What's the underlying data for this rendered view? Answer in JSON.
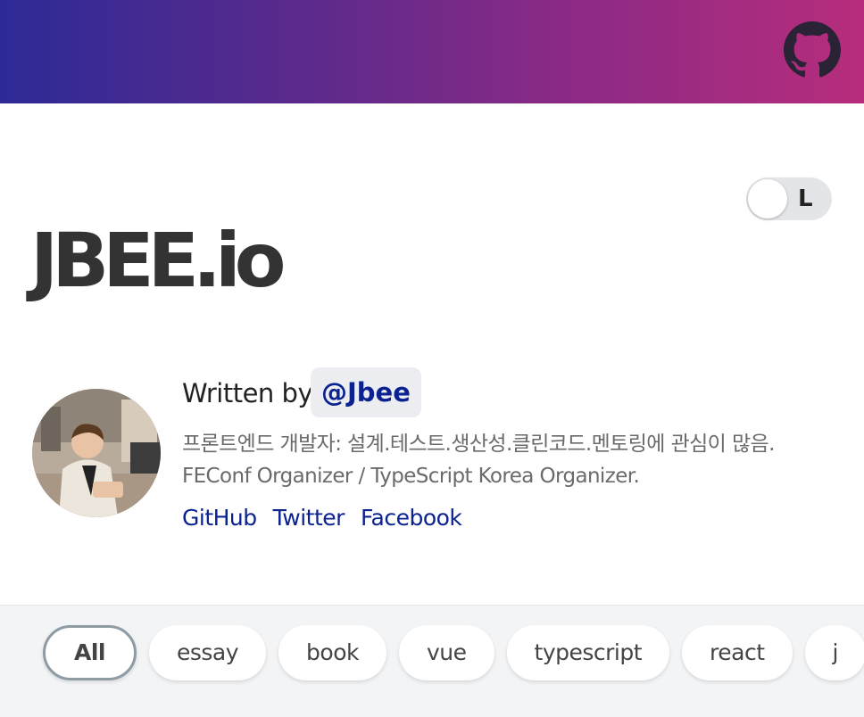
{
  "header": {
    "github_icon": "github-icon",
    "gradient_colors": [
      "#2d2a96",
      "#b72d7c"
    ]
  },
  "theme_toggle": {
    "label": "L"
  },
  "site": {
    "title": "JBEE.io"
  },
  "bio": {
    "written_by": "Written by",
    "handle": "@Jbee",
    "description_line1": "프론트엔드 개발자: 설계.테스트.생산성.클린코드.멘토링에 관심이 많음.",
    "description_line2": "FEConf Organizer / TypeScript Korea Organizer.",
    "links": [
      "GitHub",
      "Twitter",
      "Facebook"
    ],
    "link_color": "#0b2290"
  },
  "categories": {
    "items": [
      "All",
      "essay",
      "book",
      "vue",
      "typescript",
      "react",
      "j"
    ],
    "selected": "All"
  }
}
